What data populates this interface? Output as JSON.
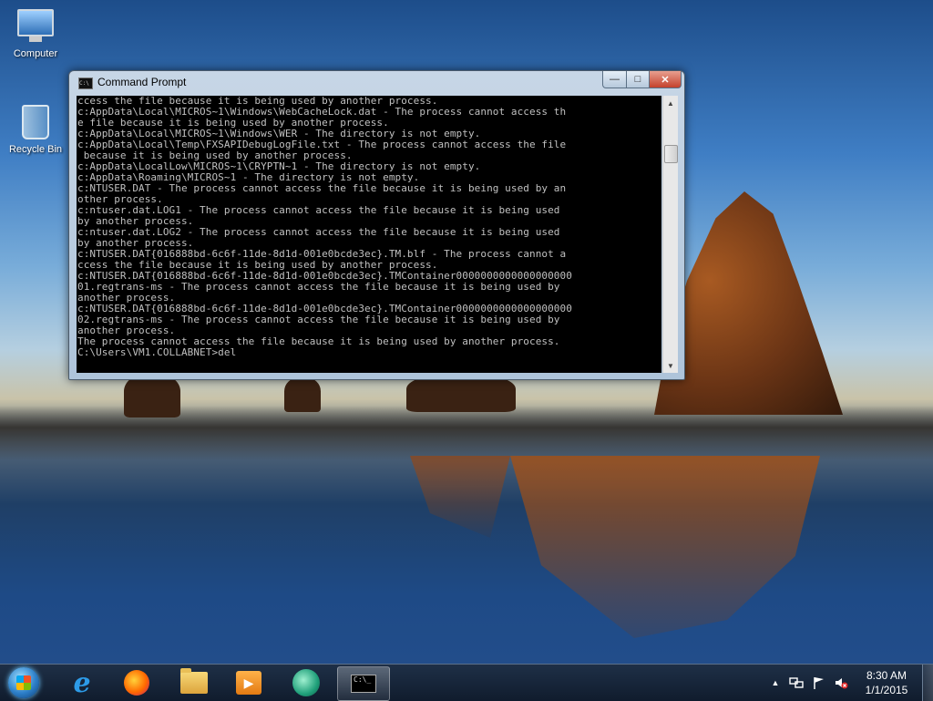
{
  "desktop": {
    "icons": [
      {
        "label": "Computer"
      },
      {
        "label": "Recycle Bin"
      }
    ]
  },
  "window": {
    "title": "Command Prompt",
    "controls": {
      "minimize": "—",
      "maximize": "□",
      "close": "✕"
    },
    "icon_text": "C:\\",
    "lines": [
      "ccess the file because it is being used by another process.",
      "c:AppData\\Local\\MICROS~1\\Windows\\WebCacheLock.dat - The process cannot access th",
      "e file because it is being used by another process.",
      "c:AppData\\Local\\MICROS~1\\Windows\\WER - The directory is not empty.",
      "c:AppData\\Local\\Temp\\FXSAPIDebugLogFile.txt - The process cannot access the file",
      " because it is being used by another process.",
      "c:AppData\\LocalLow\\MICROS~1\\CRYPTN~1 - The directory is not empty.",
      "c:AppData\\Roaming\\MICROS~1 - The directory is not empty.",
      "c:NTUSER.DAT - The process cannot access the file because it is being used by an",
      "other process.",
      "c:ntuser.dat.LOG1 - The process cannot access the file because it is being used",
      "by another process.",
      "c:ntuser.dat.LOG2 - The process cannot access the file because it is being used",
      "by another process.",
      "c:NTUSER.DAT{016888bd-6c6f-11de-8d1d-001e0bcde3ec}.TM.blf - The process cannot a",
      "ccess the file because it is being used by another process.",
      "c:NTUSER.DAT{016888bd-6c6f-11de-8d1d-001e0bcde3ec}.TMContainer0000000000000000000",
      "01.regtrans-ms - The process cannot access the file because it is being used by",
      "another process.",
      "c:NTUSER.DAT{016888bd-6c6f-11de-8d1d-001e0bcde3ec}.TMContainer0000000000000000000",
      "02.regtrans-ms - The process cannot access the file because it is being used by",
      "another process.",
      "The process cannot access the file because it is being used by another process.",
      "",
      "C:\\Users\\VM1.COLLABNET>del"
    ]
  },
  "taskbar": {
    "items": [
      {
        "name": "Internet Explorer"
      },
      {
        "name": "Firefox"
      },
      {
        "name": "Windows Explorer"
      },
      {
        "name": "Windows Media Player"
      },
      {
        "name": "App"
      },
      {
        "name": "Command Prompt",
        "active": true
      }
    ],
    "cmd_icon_text": "C:\\_",
    "ie_glyph": "e",
    "media_glyph": "▶",
    "tray": {
      "chevron": "▲",
      "network_icon": "network-icon",
      "flag_icon": "action-center-flag-icon",
      "volume_icon": "volume-muted-icon"
    },
    "clock": {
      "time": "8:30 AM",
      "date": "1/1/2015"
    }
  }
}
